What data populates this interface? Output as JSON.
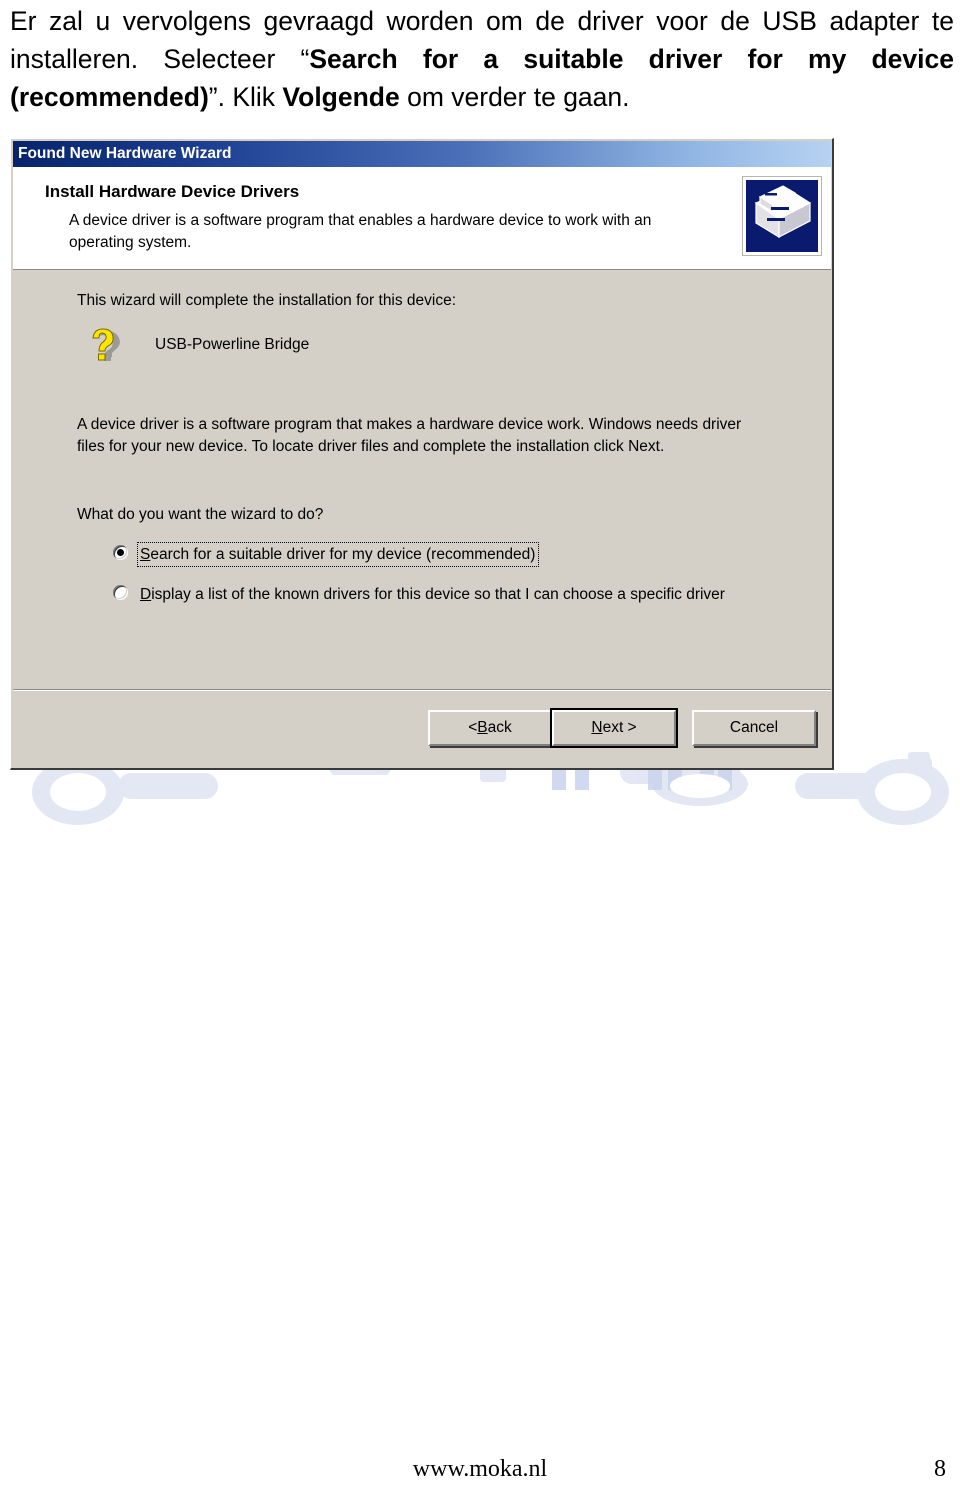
{
  "document": {
    "paragraph_runs": [
      {
        "text": "Er zal u vervolgens gevraagd worden om de driver voor de USB adapter te installeren. Selecteer “",
        "bold": false
      },
      {
        "text": "Search for a suitable driver for my device (recommended)",
        "bold": true
      },
      {
        "text": "”. Klik ",
        "bold": false
      },
      {
        "text": "Volgende",
        "bold": true
      },
      {
        "text": " om verder te gaan.",
        "bold": false
      }
    ],
    "paragraph_plain": "Er zal u vervolgens gevraagd worden om de driver voor de USB adapter te installeren. Selecteer “Search for a suitable driver for my device (recommended)”. Klik Volgende om verder te gaan."
  },
  "wizard": {
    "titlebar": {
      "title": "Found New Hardware Wizard",
      "gradient_from": "#07246b",
      "gradient_to": "#b6d2f2"
    },
    "header": {
      "title": "Install Hardware Device Drivers",
      "description": "A device driver is a software program that enables a hardware device to work with an operating system.",
      "icon": "add-new-hardware-icon",
      "icon_bg": "#0a1a6e"
    },
    "body": {
      "prompt_device": "This wizard will complete the installation for this device:",
      "device_icon": "unknown-device-question-mark-icon",
      "device_icon_color": "#ffe400",
      "device_name": "USB-Powerline Bridge",
      "paragraph": "A device driver is a software program that makes a hardware device work. Windows needs driver files for your new device. To locate driver files and complete the installation click Next.",
      "prompt_question": "What do you want the wizard to do?",
      "options": [
        {
          "accelerator": "S",
          "label_rest": "earch for a suitable driver for my device (recommended)",
          "label_full": "Search for a suitable driver for my device (recommended)",
          "selected": true,
          "focused": true
        },
        {
          "accelerator": "D",
          "label_rest": "isplay a list of the known drivers for this device so that I can choose a specific driver",
          "label_full": "Display a list of the known drivers for this device so that I can choose a specific driver",
          "selected": false,
          "focused": false
        }
      ]
    },
    "buttons": [
      {
        "name": "back",
        "prefix": "< ",
        "accelerator": "B",
        "suffix": "ack",
        "label_full": "< Back",
        "default": false
      },
      {
        "name": "next",
        "prefix": "",
        "accelerator": "N",
        "suffix": "ext >",
        "label_full": "Next >",
        "default": true
      },
      {
        "name": "cancel",
        "prefix": "",
        "accelerator": "",
        "suffix": "Cancel",
        "label_full": "Cancel",
        "default": false
      }
    ],
    "window_bg": "#d4d0c8"
  },
  "page_footer": {
    "url": "www.moka.nl",
    "page_number": "8"
  }
}
